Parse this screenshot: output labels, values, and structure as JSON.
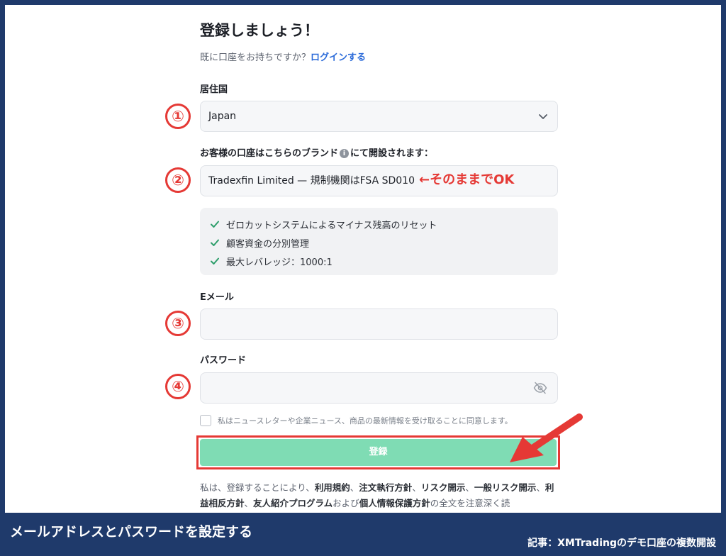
{
  "form": {
    "title": "登録しましょう！",
    "login_prompt": "既に口座をお持ちですか？",
    "login_link": "ログインする",
    "country_label": "居住国",
    "country_value": "Japan",
    "brand_label_pre": "お客様の口座はこちらのブランド",
    "brand_label_post": "にて開設されます：",
    "brand_value": "Tradexfin Limited — 規制機関はFSA SD010",
    "features": [
      "ゼロカットシステムによるマイナス残高のリセット",
      "顧客資金の分別管理",
      "最大レバレッジ：1000:1"
    ],
    "email_label": "Eメール",
    "email_value": "",
    "password_label": "パスワード",
    "password_value": "",
    "consent_text": "私はニュースレターや企業ニュース、商品の最新情報を受け取ることに同意します。",
    "submit_label": "登録",
    "terms": {
      "p1": "私は、登録することにより、",
      "l1": "利用規約",
      "s1": "、",
      "l2": "注文執行方針",
      "s2": "、",
      "l3": "リスク開示",
      "s3": "、",
      "l4": "一般リスク開示",
      "s4": "、",
      "l5": "利益相反方針",
      "s5": "、",
      "l6": "友人紹介プログラム",
      "p2": "および",
      "l7": "個人情報保護方針",
      "p3": "の全文を注意深く読"
    }
  },
  "annotations": {
    "step1": "①",
    "step2": "②",
    "step3": "③",
    "step4": "④",
    "note": "←そのままでOK"
  },
  "footer": {
    "caption": "メールアドレスとパスワードを設定する",
    "credit": "記事：XMTradingのデモ口座の複数開設"
  },
  "colors": {
    "frame": "#1f3a6b",
    "accent_red": "#e53935",
    "submit": "#7fdcb4",
    "link": "#2a6ad9",
    "check": "#2e9e6b"
  },
  "icons": [
    "chevron-down-icon",
    "info-icon",
    "check-icon",
    "eye-off-icon",
    "red-arrow-icon"
  ]
}
